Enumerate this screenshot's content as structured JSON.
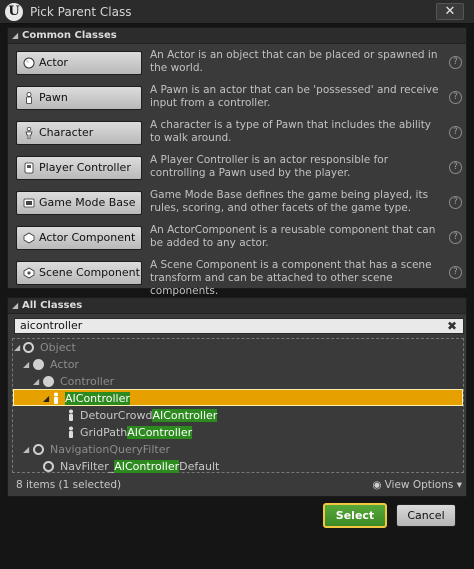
{
  "window": {
    "title": "Pick Parent Class",
    "close_glyph": "✕",
    "logo_glyph": "U"
  },
  "common": {
    "header": "Common Classes",
    "items": [
      {
        "label": "Actor",
        "icon": "sphere-icon",
        "desc": "An Actor is an object that can be placed or spawned in the world."
      },
      {
        "label": "Pawn",
        "icon": "pawn-icon",
        "desc": "A Pawn is an actor that can be 'possessed' and receive input from a controller."
      },
      {
        "label": "Character",
        "icon": "character-icon",
        "desc": "A character is a type of Pawn that includes the ability to walk around."
      },
      {
        "label": "Player Controller",
        "icon": "controller-icon",
        "desc": "A Player Controller is an actor responsible for controlling a Pawn used by the player."
      },
      {
        "label": "Game Mode Base",
        "icon": "game-mode-icon",
        "desc": "Game Mode Base defines the game being played, its rules, scoring, and other facets of the game type."
      },
      {
        "label": "Actor Component",
        "icon": "component-icon",
        "desc": "An ActorComponent is a reusable component that can be added to any actor."
      },
      {
        "label": "Scene Component",
        "icon": "scene-component-icon",
        "desc": "A Scene Component is a component that has a scene transform and can be attached to other scene components."
      }
    ],
    "help_glyph": "?"
  },
  "all": {
    "header": "All Classes",
    "search_value": "aicontroller",
    "clear_glyph": "✖",
    "tree": [
      {
        "pre": "Object",
        "hl": "",
        "post": "",
        "muted": true
      },
      {
        "pre": "Actor",
        "hl": "",
        "post": "",
        "muted": true
      },
      {
        "pre": "Controller",
        "hl": "",
        "post": "",
        "muted": true
      },
      {
        "pre": "",
        "hl": "AIController",
        "post": "",
        "muted": false,
        "selected": true
      },
      {
        "pre": "DetourCrowd",
        "hl": "AIController",
        "post": "",
        "muted": false
      },
      {
        "pre": "GridPath",
        "hl": "AIController",
        "post": "",
        "muted": false
      },
      {
        "pre": "NavigationQueryFilter",
        "hl": "",
        "post": "",
        "muted": true
      },
      {
        "pre": "NavFilter_",
        "hl": "AIController",
        "post": "Default",
        "muted": false
      }
    ],
    "status": "8 items (1 selected)",
    "view_options": "View Options",
    "view_options_chevron": "▾"
  },
  "footer": {
    "select_label": "Select",
    "cancel_label": "Cancel"
  },
  "colors": {
    "selection": "#e6a100",
    "match_highlight": "#2d8a1f",
    "select_button": "#4c9a30"
  }
}
